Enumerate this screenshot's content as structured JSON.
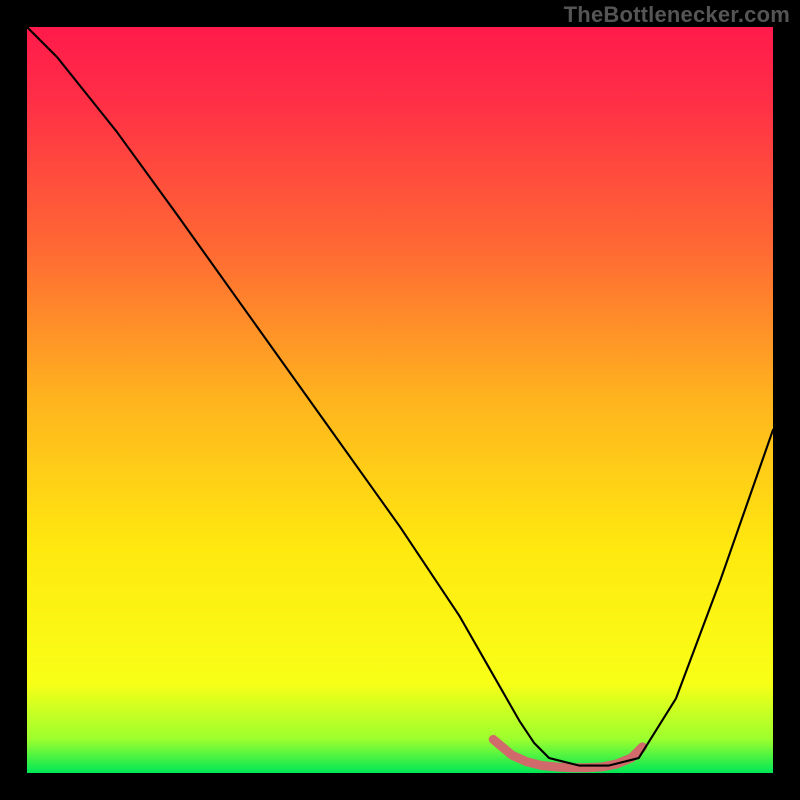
{
  "attribution": "TheBottlenecker.com",
  "chart_data": {
    "type": "line",
    "title": "",
    "xlabel": "",
    "ylabel": "",
    "legend": null,
    "annotations": [],
    "grid": false,
    "xlim": [
      0,
      100
    ],
    "ylim": [
      0,
      100
    ],
    "gradient_stops": [
      {
        "offset": 0.0,
        "color": "#ff1a4b"
      },
      {
        "offset": 0.1,
        "color": "#ff2f46"
      },
      {
        "offset": 0.3,
        "color": "#ff6a33"
      },
      {
        "offset": 0.5,
        "color": "#ffb41e"
      },
      {
        "offset": 0.7,
        "color": "#ffe90f"
      },
      {
        "offset": 0.88,
        "color": "#f8ff17"
      },
      {
        "offset": 0.955,
        "color": "#9bff2e"
      },
      {
        "offset": 1.0,
        "color": "#00e756"
      }
    ],
    "series": [
      {
        "name": "curve",
        "color": "#000000",
        "stroke_width": 2.1,
        "x": [
          0,
          4,
          8,
          12,
          20,
          30,
          40,
          50,
          58,
          62,
          66,
          68,
          70,
          74,
          78,
          82,
          87,
          93,
          100
        ],
        "y": [
          100,
          96,
          91,
          86,
          75,
          61,
          47,
          33,
          21,
          14,
          7,
          4,
          2,
          1,
          1,
          2,
          10,
          26,
          46
        ]
      }
    ],
    "highlight": {
      "color": "#d16a6a",
      "stroke_width": 9,
      "x": [
        62.5,
        65,
        67,
        69,
        71,
        73,
        75,
        77,
        79,
        81,
        82.5
      ],
      "y": [
        4.5,
        2.4,
        1.5,
        1.0,
        0.8,
        0.7,
        0.7,
        0.8,
        1.2,
        2.0,
        3.5
      ]
    }
  }
}
